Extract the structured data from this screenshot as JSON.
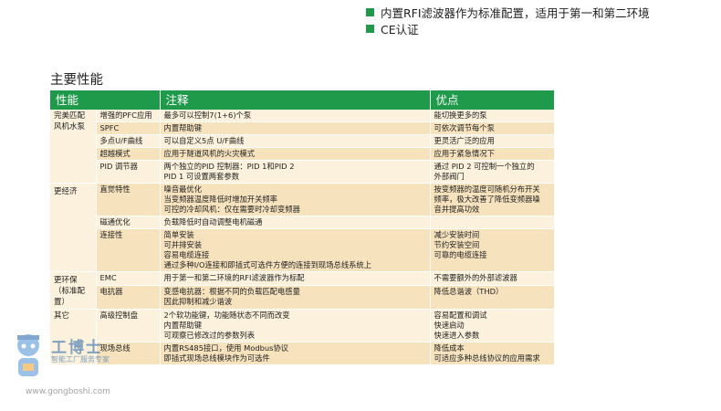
{
  "bullets": [
    "内置RFI滤波器作为标准配置，适用于第一和第二环境",
    "CE认证"
  ],
  "section_title": "主要性能",
  "table": {
    "headers": [
      "性能",
      "注释",
      "优点"
    ],
    "groups": [
      {
        "category": "完美匹配风机水泵",
        "rows": [
          {
            "sub": "增强的PFC应用",
            "note": [
              "最多可以控制7(1+6)个泵"
            ],
            "adv": [
              "能切换更多的泵"
            ]
          },
          {
            "sub": "SPFC",
            "note": [
              "内置帮助键"
            ],
            "adv": [
              "可依次调节每个泵"
            ]
          },
          {
            "sub": "多点U/F曲线",
            "note": [
              "可以自定义5点  U/F曲线"
            ],
            "adv": [
              "更灵活广泛的应用"
            ]
          },
          {
            "sub": "超越模式",
            "note": [
              "应用于隧道风机的火灾模式"
            ],
            "adv": [
              "应用于紧急情况下"
            ]
          },
          {
            "sub": "PID 调节器",
            "note": [
              "两个独立的PID 控制器：PID 1和PID 2",
              "PID 1 可设置两套参数"
            ],
            "adv": [
              "通过  PID 2 可控制一个独立的",
              "外部阀门"
            ]
          }
        ]
      },
      {
        "category": "更经济",
        "rows": [
          {
            "sub": "直觉特性",
            "note": [
              "噪音最优化",
              "当变频器温度降低时增加开关频率",
              "可控的冷却风机：仅在需要时冷却变频器"
            ],
            "adv": [
              "按变频器的温度可随机分布开关",
              "频率，极大改善了降低变频器噪",
              "音并提高功效"
            ]
          },
          {
            "sub": "磁通优化",
            "note": [
              "负载降低时自动调整电机磁通"
            ],
            "adv": [
              ""
            ]
          },
          {
            "sub": "连接性",
            "note": [
              "简单安装",
              "可并排安装",
              "容易电缆连接",
              "通过多种I/O连接和即插式可选件方便的连接到现场总线系统上"
            ],
            "adv": [
              "减少安装时间",
              "节约安装空间",
              "可靠的电缆连接"
            ]
          }
        ]
      },
      {
        "category": "更环保（标准配置）",
        "rows": [
          {
            "sub": "EMC",
            "note": [
              "用于第一和第二环境的RFI滤波器作为标配"
            ],
            "adv": [
              "不需要额外的外部滤波器"
            ]
          },
          {
            "sub": "电抗器",
            "note": [
              "变感电抗器：根据不同的负载匹配电感量",
              "因此抑制和减少谐波"
            ],
            "adv": [
              "降低总谐波（THD）"
            ]
          }
        ]
      },
      {
        "category": "其它",
        "rows": [
          {
            "sub": "高级控制盘",
            "note": [
              "2个软功能键，功能随状态不同而改变",
              "内置帮助键",
              "可观察已修改过的参数列表"
            ],
            "adv": [
              "容易配置和调试",
              "快速启动",
              "快速进入参数"
            ]
          },
          {
            "sub": "现场总线",
            "note": [
              "内置RS485接口，使用 Modbus协议",
              "即插式现场总线模块作为可选件"
            ],
            "adv": [
              "降低成本",
              "可适应多种总线协议的应用需求"
            ]
          }
        ]
      }
    ]
  },
  "watermark": {
    "title": "工博士",
    "subtitle": "智能工厂服务专家",
    "url": "www.gongboshi.com"
  },
  "colors": {
    "header_green": "#1f9a4a",
    "row_light": "#fbf1dc",
    "row_dark": "#f6e3be"
  }
}
